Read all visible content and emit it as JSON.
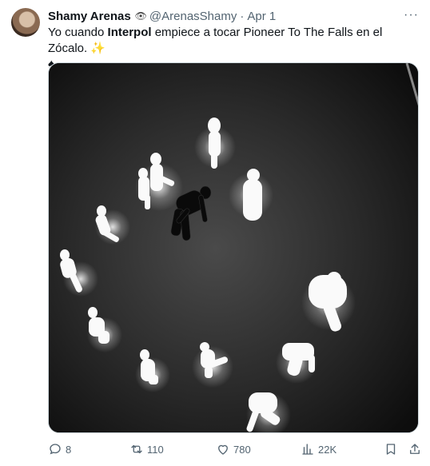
{
  "author": {
    "name": "Shamy Arenas",
    "badge_icon": "eye-icon",
    "handle": "@ArenasShamy",
    "separator": "·",
    "date": "Apr 1"
  },
  "tweet": {
    "text_before": "Yo cuando ",
    "text_bold": "Interpol",
    "text_after": " empiece a tocar Pioneer To The Falls en el Zócalo. ",
    "emoji_1": "✨",
    "emoji_2": "♠"
  },
  "more_label": "···",
  "media": {
    "description_icon": "photo-glowing-figures"
  },
  "actions": {
    "replies": "8",
    "retweets": "110",
    "likes": "780",
    "views": "22K"
  },
  "colors": {
    "secondary_text": "#536471",
    "border": "#cfd9de"
  }
}
